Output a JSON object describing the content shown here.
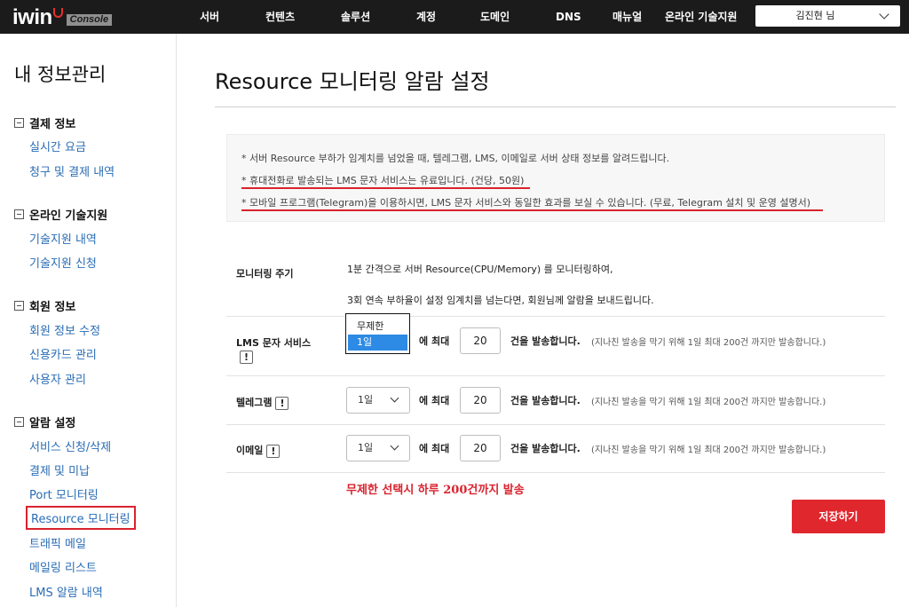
{
  "header": {
    "logo_text": "iwin",
    "logo_badge": "Console",
    "nav": [
      "서버",
      "컨텐츠",
      "솔루션",
      "계정",
      "도메인",
      "DNS",
      "매뉴얼",
      "온라인 기술지원"
    ],
    "user": "김진현 님"
  },
  "sidebar": {
    "title": "내 정보관리",
    "groups": [
      {
        "label": "결제 정보",
        "items": [
          "실시간 요금",
          "청구 및 결제 내역"
        ]
      },
      {
        "label": "온라인 기술지원",
        "items": [
          "기술지원 내역",
          "기술지원 신청"
        ]
      },
      {
        "label": "회원 정보",
        "items": [
          "회원 정보 수정",
          "신용카드 관리",
          "사용자 관리"
        ]
      },
      {
        "label": "알람 설정",
        "items": [
          "서비스 신청/삭제",
          "결제 및 미납",
          "Port 모니터링",
          "Resource 모니터링",
          "트래픽 메일",
          "메일링 리스트",
          "LMS 알람 내역"
        ]
      }
    ],
    "active_item": "Resource 모니터링"
  },
  "main": {
    "title": "Resource 모니터링 알람 설정",
    "notice": [
      "* 서버 Resource 부하가 임계치를 넘었을 때, 텔레그램, LMS, 이메일로 서버 상태 정보를 알려드립니다.",
      "* 휴대전화로 발송되는 LMS 문자 서비스는 유료입니다. (건당, 50원)",
      "* 모바일 프로그램(Telegram)을 이용하시면, LMS 문자 서비스와 동일한 효과를 보실 수 있습니다. (무료, Telegram 설치 및 운영 설명서)"
    ],
    "monitor": {
      "label": "모니터링 주기",
      "line1": "1분 간격으로 서버 Resource(CPU/Memory) 를 모니터링하여,",
      "line2": "3회 연속 부하율이 설정 임계치를 넘는다면, 회원님께 알람을 보내드립니다."
    },
    "rows": [
      {
        "label": "LMS 문자 서비스",
        "select": "1일",
        "options": [
          "무제한",
          "1일"
        ],
        "count": "20"
      },
      {
        "label": "텔레그램",
        "select": "1일",
        "count": "20"
      },
      {
        "label": "이메일",
        "select": "1일",
        "count": "20"
      }
    ],
    "excl": "!",
    "max_label": "에 최대",
    "unit": "건을 발송합니다.",
    "hint": "(지나친 발송을 막기 위해 1일 최대 200건 까지만 발송합니다.)",
    "red_note": "무제한 선택시 하루 200건까지 발송",
    "save": "저장하기"
  },
  "colors": {
    "accent_red": "#e1272e",
    "link_blue": "#2a6db5",
    "highlight": "#2d8ae5",
    "topbar": "#1b1b1b"
  }
}
